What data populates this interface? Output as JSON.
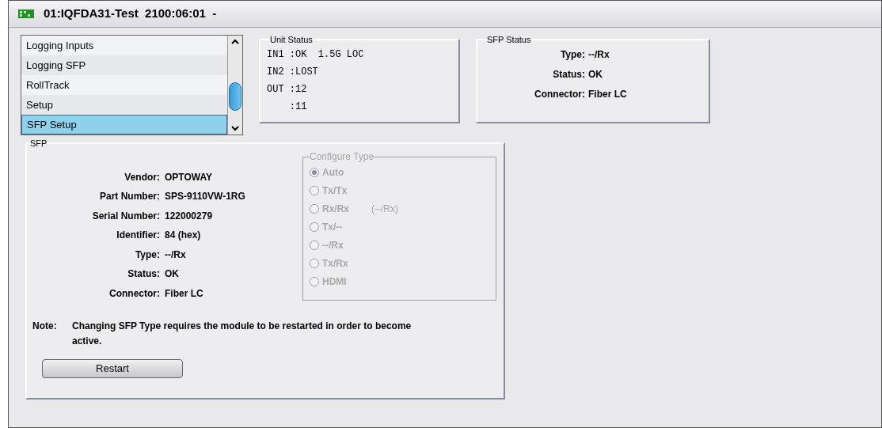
{
  "window": {
    "title": "01:IQFDA31-Test  2100:06:01  -"
  },
  "menu_list": {
    "items": [
      {
        "label": "Logging Inputs",
        "selected": false
      },
      {
        "label": "Logging SFP",
        "selected": false
      },
      {
        "label": "RollTrack",
        "selected": false
      },
      {
        "label": "Setup",
        "selected": false
      },
      {
        "label": "SFP Setup",
        "selected": true
      }
    ]
  },
  "unit_status": {
    "title": "Unit Status",
    "lines": [
      "IN1 :OK  1.5G LOC",
      "IN2 :LOST",
      "OUT :12",
      "    :11"
    ]
  },
  "sfp_status": {
    "title": "SFP Status",
    "fields": [
      {
        "label": "Type:",
        "value": "--/Rx"
      },
      {
        "label": "Status:",
        "value": "OK"
      },
      {
        "label": "Connector:",
        "value": "Fiber LC"
      }
    ]
  },
  "sfp": {
    "title": "SFP",
    "fields": [
      {
        "label": "Vendor:",
        "value": "OPTOWAY"
      },
      {
        "label": "Part Number:",
        "value": "SPS-9110VW-1RG"
      },
      {
        "label": "Serial Number:",
        "value": "122000279"
      },
      {
        "label": "Identifier:",
        "value": "84 (hex)"
      },
      {
        "label": "Type:",
        "value": "--/Rx"
      },
      {
        "label": "Status:",
        "value": "OK"
      },
      {
        "label": "Connector:",
        "value": "Fiber LC"
      }
    ],
    "configure_type": {
      "title": "Configure Type",
      "disabled": true,
      "options": [
        {
          "label": "Auto",
          "selected": true
        },
        {
          "label": "Tx/Tx",
          "selected": false
        },
        {
          "label": "Rx/Rx",
          "selected": false,
          "note": "(--/Rx)"
        },
        {
          "label": "Tx/--",
          "selected": false
        },
        {
          "label": "--/Rx",
          "selected": false
        },
        {
          "label": "Tx/Rx",
          "selected": false
        },
        {
          "label": "HDMI",
          "selected": false
        }
      ]
    },
    "note_label": "Note:",
    "note": "Changing SFP Type requires the module to be restarted in order to become active.",
    "restart_button": "Restart"
  }
}
